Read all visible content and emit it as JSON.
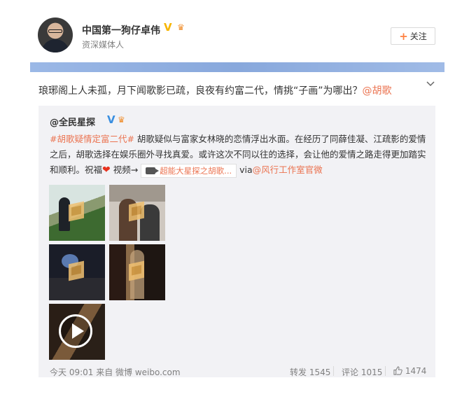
{
  "post": {
    "author_name": "中国第一狗仔卓伟",
    "author_subtitle": "资深媒体人",
    "follow_label": "关注",
    "body_text": "琅琊阁上人未孤，月下闻歌影已疏，良夜有约富二代，情挑“子画”为哪出？",
    "body_mention": "@胡歌"
  },
  "repost": {
    "user": "@全民星探",
    "hashtag": "#胡歌疑情定富二代#",
    "text_part1": " 胡歌疑似与富家女林晓的恋情浮出水面。在经历了同薛佳凝、江疏影的爱情之后，胡歌选择在娱乐圈外寻找真爱。或许这次不同以往的选择，会让他的爱情之路走得更加踏实和顺利。祝福",
    "text_video": " 视频→",
    "video_title": "超能大星探之胡歌...",
    "via_prefix": " via",
    "via_link": "@风行工作室官微",
    "time_source": "今天 09:01 来自 微博 weibo.com",
    "repost_label": "转发",
    "repost_count": "1545",
    "comment_label": "评论",
    "comment_count": "1015",
    "like_count": "1474"
  },
  "colors": {
    "accent": "#eb7350",
    "banner": "#9bb8e6",
    "repost_bg": "#f2f2f5"
  },
  "icons": [
    "verified-v-icon",
    "crown-icon",
    "plus-icon",
    "chevron-down-icon",
    "heart-icon",
    "video-icon",
    "play-icon",
    "thumbs-up-icon"
  ]
}
